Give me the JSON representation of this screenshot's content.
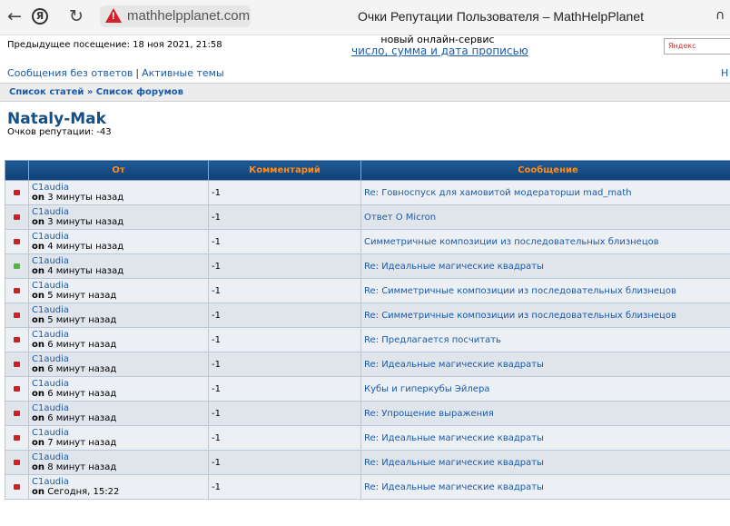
{
  "browser": {
    "back_icon": "←",
    "yandex_icon": "Я",
    "reload_icon": "↻",
    "warning_icon": "!",
    "url": "mathhelpplanet.com",
    "title": "Очки Репутации Пользователя – MathHelpPlanet",
    "headphones_icon": "∩"
  },
  "header": {
    "last_visit": "Предыдущее посещение: 18 ноя 2021, 21:58",
    "ad_text": "новый онлайн-сервис",
    "ad_link": "число, сумма и дата прописью",
    "search_placeholder": "Яндекс",
    "quick_links": [
      "Сообщения без ответов",
      "Активные темы"
    ],
    "quick_links_sep": "|",
    "right_edge_link": "Н"
  },
  "breadcrumb": "Список статей » Список форумов",
  "profile": {
    "username": "Nataly-Mak",
    "reputation_line": "Очков репутации: -43"
  },
  "table": {
    "headers": [
      "",
      "От",
      "Комментарий",
      "Сообщение"
    ],
    "rows": [
      {
        "status": "negative",
        "from": "C1audia",
        "on": "on",
        "time": "3 минуты назад",
        "comment": "-1",
        "message": "Re: Говноспуск для хамовитой модераторши mad_math"
      },
      {
        "status": "negative",
        "from": "C1audia",
        "on": "on",
        "time": "3 минуты назад",
        "comment": "-1",
        "message": "Ответ O Micron"
      },
      {
        "status": "negative",
        "from": "C1audia",
        "on": "on",
        "time": "4 минуты назад",
        "comment": "-1",
        "message": "Симметричные композиции из последовательных близнецов"
      },
      {
        "status": "positive",
        "from": "C1audia",
        "on": "on",
        "time": "4 минуты назад",
        "comment": "-1",
        "message": "Re: Идеальные магические квадраты"
      },
      {
        "status": "negative",
        "from": "C1audia",
        "on": "on",
        "time": "5 минут назад",
        "comment": "-1",
        "message": "Re: Симметричные композиции из последовательных близнецов"
      },
      {
        "status": "negative",
        "from": "C1audia",
        "on": "on",
        "time": "5 минут назад",
        "comment": "-1",
        "message": "Re: Симметричные композиции из последовательных близнецов"
      },
      {
        "status": "negative",
        "from": "C1audia",
        "on": "on",
        "time": "6 минут назад",
        "comment": "-1",
        "message": "Re: Предлагается посчитать"
      },
      {
        "status": "negative",
        "from": "C1audia",
        "on": "on",
        "time": "6 минут назад",
        "comment": "-1",
        "message": "Re: Идеальные магические квадраты"
      },
      {
        "status": "negative",
        "from": "C1audia",
        "on": "on",
        "time": "6 минут назад",
        "comment": "-1",
        "message": "Кубы и гиперкубы Эйлера"
      },
      {
        "status": "negative",
        "from": "C1audia",
        "on": "on",
        "time": "6 минут назад",
        "comment": "-1",
        "message": "Re: Упрощение выражения"
      },
      {
        "status": "negative",
        "from": "C1audia",
        "on": "on",
        "time": "7 минут назад",
        "comment": "-1",
        "message": "Re: Идеальные магические квадраты"
      },
      {
        "status": "negative",
        "from": "C1audia",
        "on": "on",
        "time": "8 минут назад",
        "comment": "-1",
        "message": "Re: Идеальные магические квадраты"
      },
      {
        "status": "negative",
        "from": "C1audia",
        "on": "on",
        "time": "Сегодня, 15:22",
        "comment": "-1",
        "message": "Re: Идеальные магические квадраты"
      }
    ]
  },
  "colors": {
    "negative": "#cc2222",
    "positive": "#4fb83a",
    "header_text": "#ff8c1a",
    "link": "#1b5aa8"
  }
}
